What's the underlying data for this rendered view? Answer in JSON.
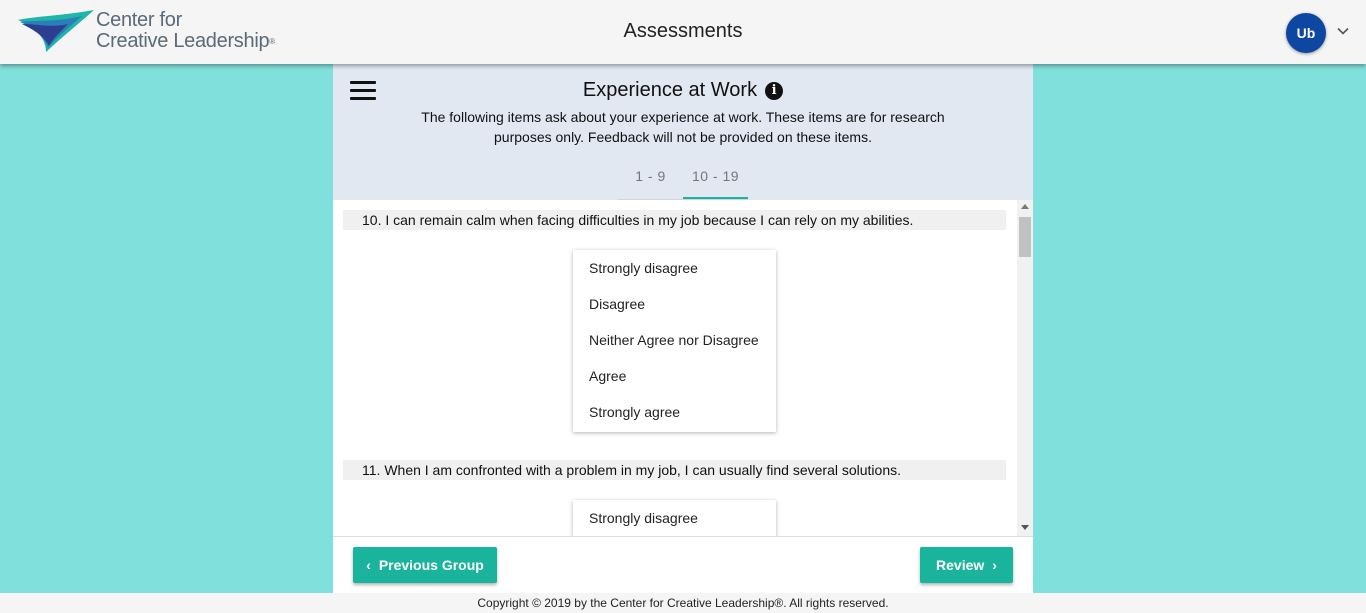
{
  "header": {
    "brand_line1": "Center for",
    "brand_line2": "Creative Leadership",
    "brand_tm": "®",
    "title": "Assessments",
    "avatar_initials": "Ub",
    "avatar_color": "#0d47a1"
  },
  "section": {
    "title": "Experience at Work",
    "info_glyph": "i",
    "description": "The following items ask about your experience at work. These items are for research purposes only. Feedback will not be provided on these items.",
    "tabs": [
      {
        "label": "1 - 9",
        "active": false
      },
      {
        "label": "10 - 19",
        "active": true
      }
    ]
  },
  "questions": [
    {
      "text": "10. I can remain calm when facing difficulties in my job because I can rely on my abilities.",
      "options": [
        "Strongly disagree",
        "Disagree",
        "Neither Agree nor Disagree",
        "Agree",
        "Strongly agree"
      ]
    },
    {
      "text": "11. When I am confronted with a problem in my job, I can usually find several solutions.",
      "options": [
        "Strongly disagree"
      ]
    }
  ],
  "footer": {
    "prev_label": "Previous Group",
    "review_label": "Review",
    "copyright": "Copyright © 2019 by the Center for Creative Leadership®. All rights reserved."
  },
  "colors": {
    "accent": "#1ab39b",
    "background": "#80e0dc",
    "panel_header": "#e1e8f2"
  }
}
